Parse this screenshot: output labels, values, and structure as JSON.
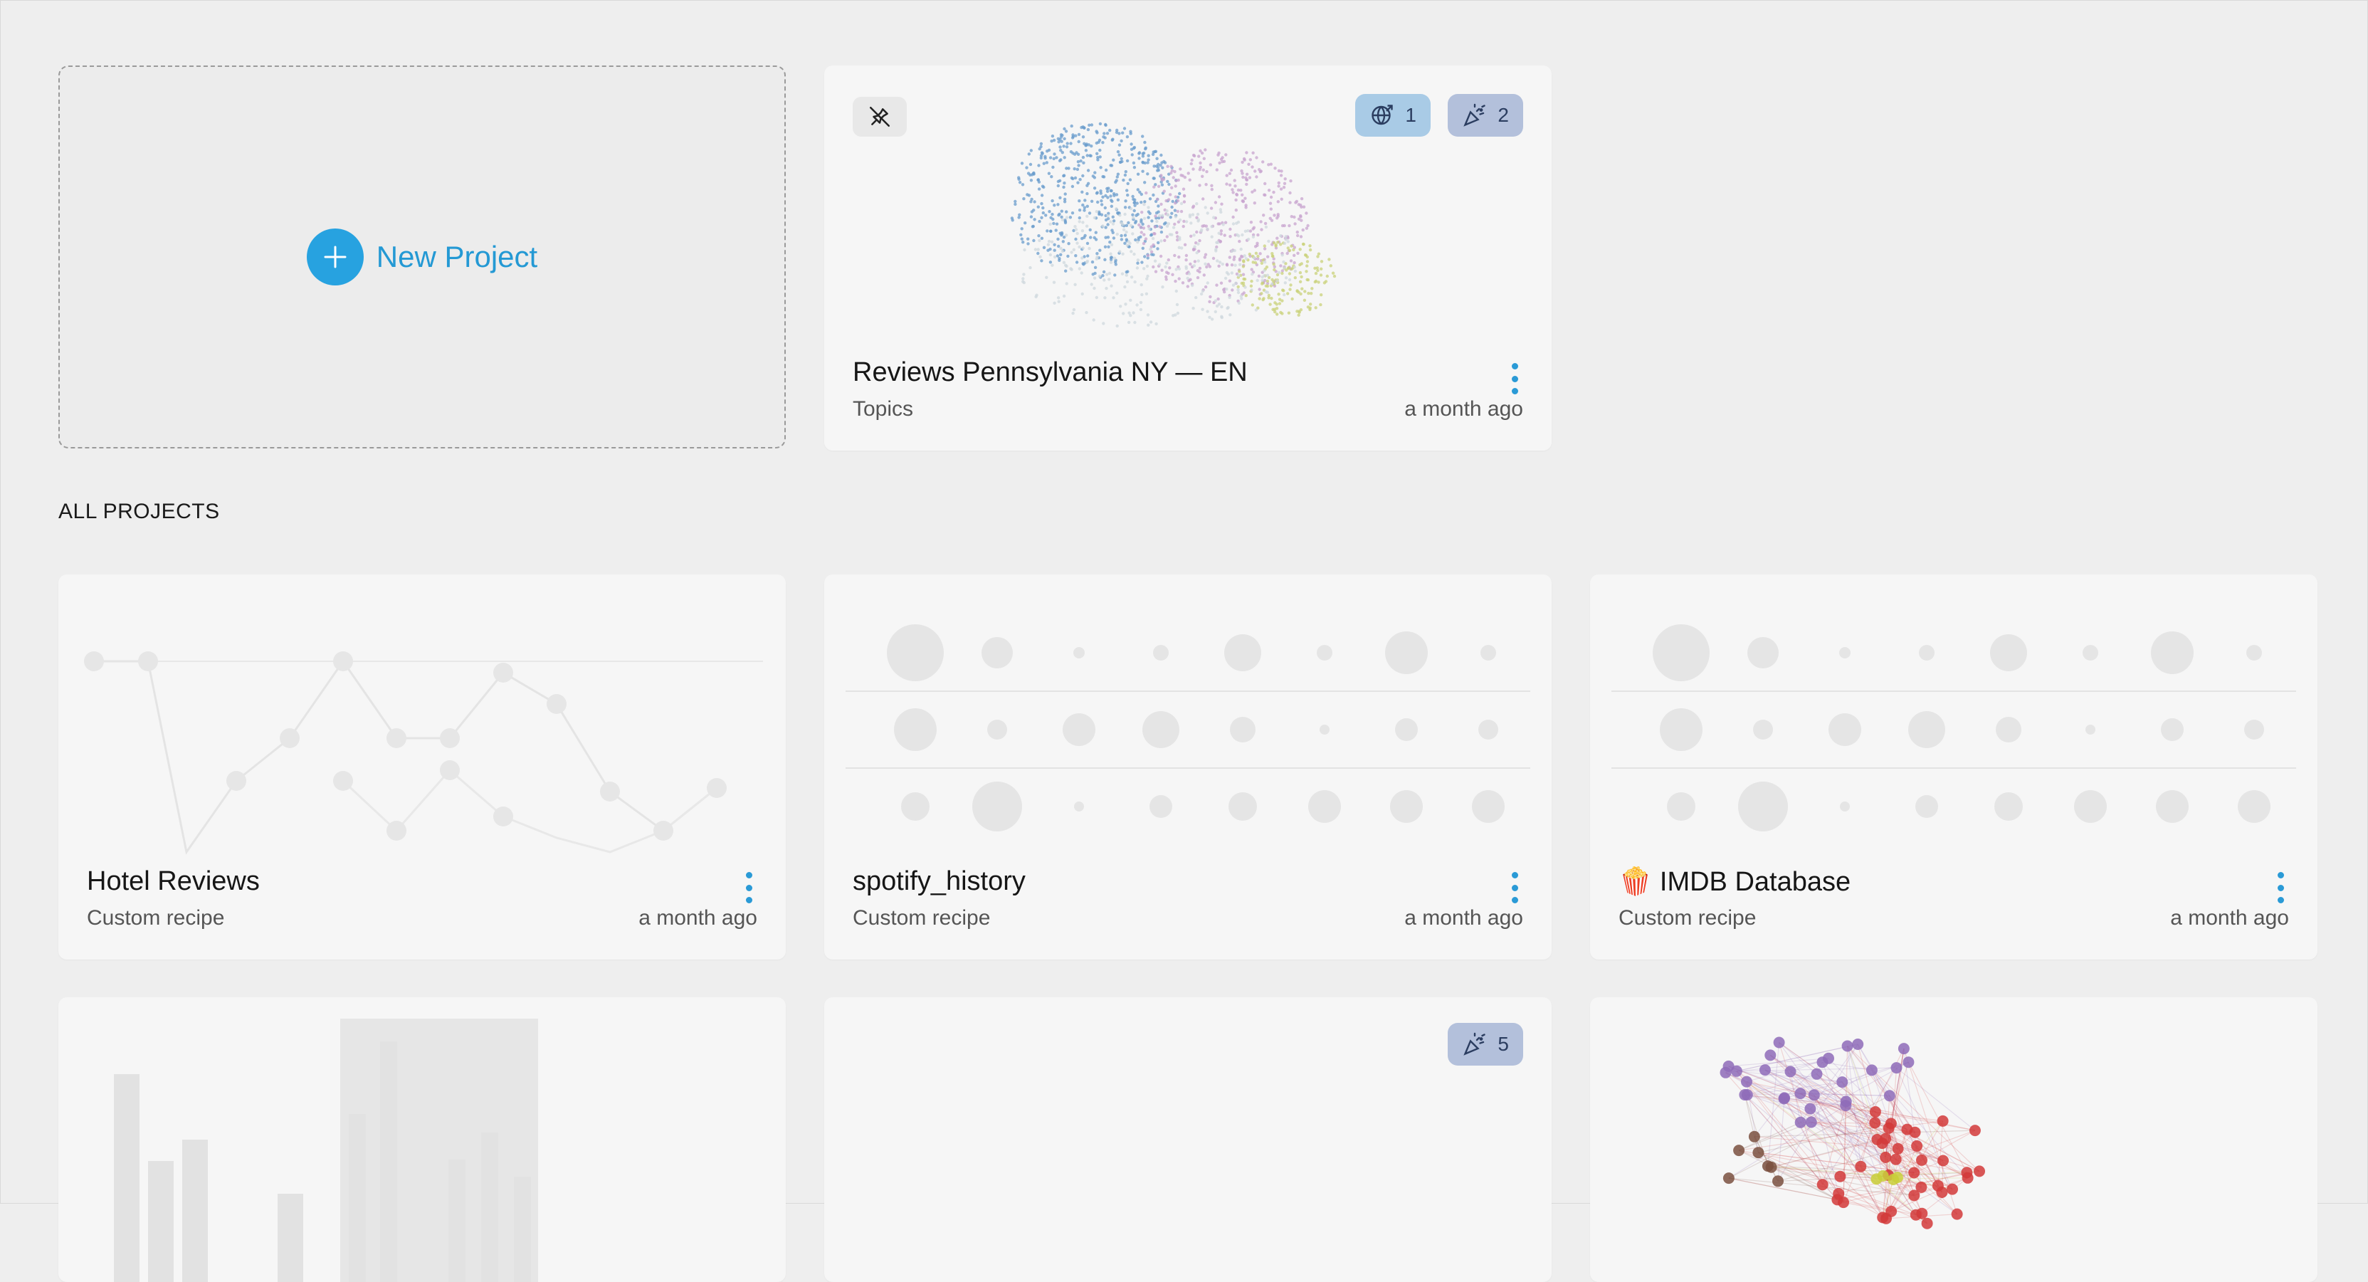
{
  "new_project": {
    "label": "New Project"
  },
  "section_label": "ALL PROJECTS",
  "pinned": {
    "title": "Reviews Pennsylvania NY — EN",
    "type": "Topics",
    "time": "a month ago",
    "badges": [
      {
        "icon": "globe-share-icon",
        "count": "1"
      },
      {
        "icon": "party-popper-icon",
        "count": "2"
      }
    ]
  },
  "projects": [
    {
      "title": "Hotel Reviews",
      "type": "Custom recipe",
      "time": "a month ago"
    },
    {
      "title": "spotify_history",
      "type": "Custom recipe",
      "time": "a month ago"
    },
    {
      "emoji": "🍿",
      "title": "IMDB Database",
      "type": "Custom recipe",
      "time": "a month ago"
    }
  ],
  "row3": {
    "middle_badge": {
      "icon": "party-popper-icon",
      "count": "5"
    }
  },
  "colors": {
    "accent": "#27a2e0",
    "globe_badge_bg": "#a9cbe6",
    "party_badge_bg": "#b3c0db",
    "background": "#eeeeee",
    "card_bg": "#f6f6f6"
  }
}
